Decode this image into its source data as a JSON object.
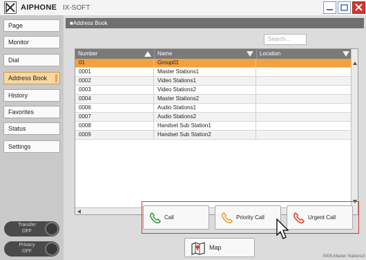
{
  "app": {
    "brand": "AIPHONE",
    "product": "IX-SOFT"
  },
  "window_controls": {
    "minimize_icon": "minimize-icon",
    "maximize_icon": "maximize-icon",
    "close_icon": "close-icon"
  },
  "sidebar": {
    "items": [
      {
        "label": "Page",
        "active": false
      },
      {
        "label": "Monitor",
        "active": false
      },
      {
        "label": "Dial",
        "active": false
      },
      {
        "label": "Address Book",
        "active": true
      },
      {
        "label": "History",
        "active": false
      },
      {
        "label": "Favorites",
        "active": false
      },
      {
        "label": "Status",
        "active": false
      },
      {
        "label": "Settings",
        "active": false
      }
    ],
    "transfer": {
      "label": "Transfer",
      "state": "OFF"
    },
    "privacy": {
      "label": "Privacy",
      "state": "OFF"
    }
  },
  "main": {
    "section_title": "■Address Book",
    "search_placeholder": "Search...",
    "table": {
      "columns": [
        "Number",
        "Name",
        "Location"
      ],
      "rows": [
        {
          "number": "01",
          "name": "Group01",
          "location": "",
          "selected": true
        },
        {
          "number": "0001",
          "name": "Master Stations1",
          "location": ""
        },
        {
          "number": "0002",
          "name": "Video Stations1",
          "location": ""
        },
        {
          "number": "0003",
          "name": "Video Stations2",
          "location": ""
        },
        {
          "number": "0004",
          "name": "Master Stations2",
          "location": ""
        },
        {
          "number": "0006",
          "name": "Audio Stations1",
          "location": ""
        },
        {
          "number": "0007",
          "name": "Audio Stations2",
          "location": ""
        },
        {
          "number": "0008",
          "name": "Handset Sub Station1",
          "location": ""
        },
        {
          "number": "0009",
          "name": "Handset Sub Station2",
          "location": ""
        }
      ]
    },
    "buttons": {
      "call": "Call",
      "priority_call": "Priority Call",
      "urgent_call": "Urgent Call",
      "map": "Map"
    },
    "status_text": "0005-Master Stations3"
  },
  "colors": {
    "selected_row": "#f3a13f",
    "active_nav": "#f6d8a0",
    "call_icon": "#3c9a4a",
    "priority_icon": "#e8a33c",
    "urgent_icon": "#d84a2a",
    "highlight_border": "#d9342b"
  }
}
